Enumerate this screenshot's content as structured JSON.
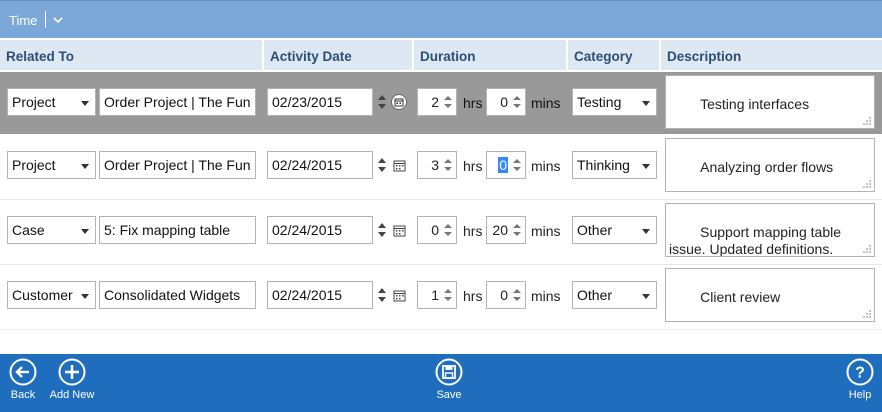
{
  "header": {
    "title": "Time"
  },
  "columns": [
    "Related To",
    "Activity Date",
    "Duration",
    "Category",
    "Description"
  ],
  "units": {
    "hrs": "hrs",
    "mins": "mins"
  },
  "rows": [
    {
      "related_type": "Project",
      "related_name": "Order Project | The Fun",
      "date": "02/23/2015",
      "hours": "2",
      "minutes": "0",
      "category": "Testing",
      "description": "Testing interfaces"
    },
    {
      "related_type": "Project",
      "related_name": "Order Project | The Fun",
      "date": "02/24/2015",
      "hours": "3",
      "minutes": "0",
      "category": "Thinking",
      "description": "Analyzing order flows"
    },
    {
      "related_type": "Case",
      "related_name": "5: Fix mapping table",
      "date": "02/24/2015",
      "hours": "0",
      "minutes": "20",
      "category": "Other",
      "description": "Support mapping table issue. Updated definitions."
    },
    {
      "related_type": "Customer",
      "related_name": "Consolidated Widgets",
      "date": "02/24/2015",
      "hours": "1",
      "minutes": "0",
      "category": "Other",
      "description": "Client review"
    }
  ],
  "footer": {
    "back": "Back",
    "add_new": "Add New",
    "save": "Save",
    "help": "Help"
  },
  "colors": {
    "header_bg": "#7ba7d9",
    "footer_bg": "#1f6dbd",
    "selected_row": "#999999",
    "column_header_bg": "#dde8f3"
  },
  "icons": {
    "back": "arrow-left-circle-icon",
    "add": "plus-circle-icon",
    "save": "floppy-disk-icon",
    "help": "question-circle-icon",
    "calendar": "calendar-icon"
  }
}
